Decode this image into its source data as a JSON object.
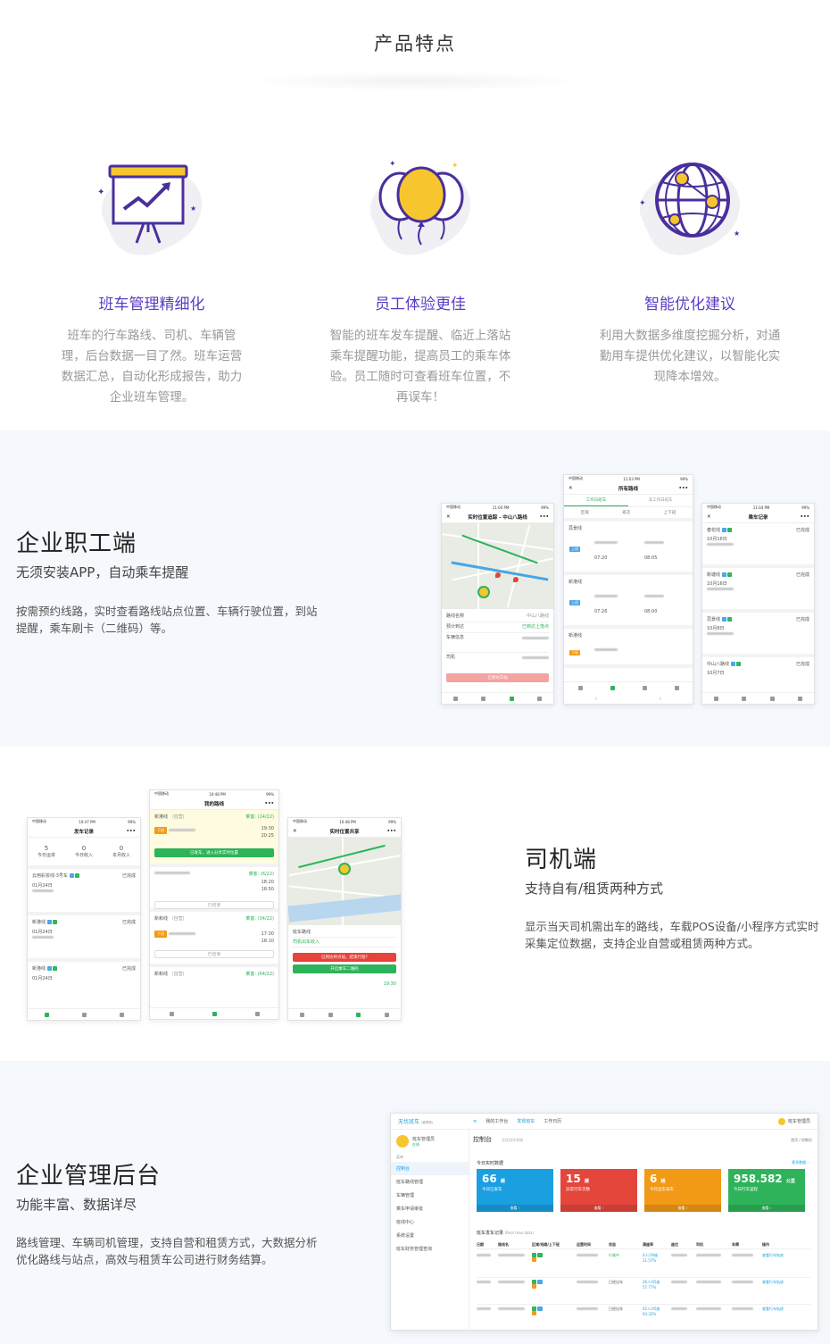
{
  "header": {
    "title": "产品特点"
  },
  "features": [
    {
      "name": "班车管理精细化",
      "icon": "presentation-chart-icon",
      "desc": "班车的行车路线、司机、车辆管理，后台数据一目了然。班车运营数据汇总，自动化形成报告，助力企业班车管理。"
    },
    {
      "name": "员工体验更佳",
      "icon": "balloon-icon",
      "desc": "智能的班车发车提醒、临近上落站乘车提醒功能，提高员工的乘车体验。员工随时可查看班车位置，不再误车！"
    },
    {
      "name": "智能优化建议",
      "icon": "globe-network-icon",
      "desc": "利用大数据多维度挖掘分析，对通勤用车提供优化建议，以智能化实现降本增效。"
    }
  ],
  "employee": {
    "title": "企业职工端",
    "subtitle": "无须安装APP，自动乘车提醒",
    "desc": "按需预约线路，实时查看路线站点位置、车辆行驶位置，到站提醒，乘车刷卡（二维码）等。",
    "phone_map": {
      "time": "11:04 PM",
      "title": "实时位置追踪 - 中山八路线",
      "route_label": "路线名称",
      "route_value": "中山八路线",
      "status_label": "预计到达",
      "status_value": "已到达上落点",
      "station_label": "车辆信息",
      "driver_label": "司机",
      "button": "已到达车站"
    },
    "phone_routes": {
      "time": "11:03 PM",
      "title": "所有路线",
      "tab_on": "工作日班车",
      "tab_off": "非工作日班车",
      "filters": [
        "区域",
        "班次",
        "上下班"
      ],
      "routes": [
        {
          "name": "荔景线",
          "tag": "上班",
          "t1": "07:20",
          "t2": "08:05"
        },
        {
          "name": "新港线",
          "tag": "上班",
          "t1": "07:26",
          "t2": "08:00"
        },
        {
          "name": "新港线",
          "tag": "下班",
          "t1": "",
          "t2": ""
        }
      ]
    },
    "phone_records": {
      "time": "11:04 PM",
      "title": "乘车记录",
      "items": [
        {
          "line": "春花线",
          "status": "已完成",
          "date": "10月16日"
        },
        {
          "line": "新塘线",
          "status": "已完成",
          "date": "10月16日"
        },
        {
          "line": "荔景线",
          "status": "已完成",
          "date": "10月8日"
        },
        {
          "line": "中山八路线",
          "status": "已完成",
          "date": "10月7日"
        }
      ]
    }
  },
  "driver": {
    "title": "司机端",
    "subtitle": "支持自有/租赁两种方式",
    "desc": "显示当天司机需出车的路线，车载POS设备/小程序方式实时采集定位数据，支持企业自营或租赁两种方式。",
    "phone_depart": {
      "time": "10:47 PM",
      "title": "发车记录",
      "stats": [
        {
          "v": "5",
          "l": "今日运单"
        },
        {
          "v": "0",
          "l": "今日收入"
        },
        {
          "v": "0",
          "l": "本月收入"
        }
      ],
      "items": [
        {
          "line": "云用彩妆线-3号车",
          "status": "已完成",
          "date": "01月24日"
        },
        {
          "line": "新港线",
          "status": "已完成",
          "date": "01月24日"
        },
        {
          "line": "新港线",
          "status": "已完成",
          "date": "01月24日"
        }
      ]
    },
    "phone_myroutes": {
      "time": "10:48 PM",
      "title": "我的路线",
      "items": [
        {
          "name": "新港线",
          "mode": "（自营)",
          "count": "乘客: (14/22)",
          "badge": "下班",
          "t1": "19:30",
          "t2": "20:25",
          "btn": "已发车，进入分享实时位置"
        },
        {
          "name": "",
          "mode": "",
          "count": "乘客: (6/22)",
          "badge": "",
          "t1": "18:20",
          "t2": "18:50",
          "btn": "已结束"
        },
        {
          "name": "新和线",
          "mode": "（自营)",
          "count": "乘客: (34/22)",
          "badge": "下班",
          "t1": "17:30",
          "t2": "18:10",
          "btn": "已结束"
        },
        {
          "name": "新和线",
          "mode": "（自营)",
          "count": "乘客: (64/22)",
          "badge": "",
          "t1": "",
          "t2": "",
          "btn": ""
        }
      ]
    },
    "phone_share": {
      "time": "10:48 PM",
      "title": "实时位置共享",
      "route_label": "班车路线",
      "income_label": "司机出车收入",
      "red_btn": "已到达终点站，结束行程?",
      "green_btn": "开启乘车二维码",
      "time_val": "19:30"
    }
  },
  "admin": {
    "title": "企业管理后台",
    "subtitle": "功能丰富、数据详尽",
    "desc": "路线管理、车辆司机管理，支持自营和租赁方式，大数据分析优化路线与站点，高效与租赁车公司进行财务结算。",
    "dash": {
      "brand": "无忧班车",
      "brand_sub": "(管理端)",
      "user": "班车管理员",
      "user_status": "在线",
      "top_tabs": [
        "我的工作台",
        "发现班车",
        "工作日历"
      ],
      "top_right": "班车管理员",
      "menu_label": "菜单",
      "menu": [
        "控制台",
        "班车路线管理",
        "车辆管理",
        "乘车申请审批",
        "班线中心",
        "系统设置",
        "班车财务管理查询"
      ],
      "page_title": "控制台",
      "page_sub": "无忧班车系统",
      "crumb": "首页 / 控制台",
      "realtime": "今日实时数据",
      "realtime_link": "更多数据 ›",
      "stats": [
        {
          "value": "66",
          "unit": "趟",
          "label": "今日已发车",
          "color": "#1a9fe0",
          "more": "查看 ›"
        },
        {
          "value": "15",
          "unit": "趟",
          "label": "异常行车次数",
          "color": "#e4463c",
          "more": "查看 ›"
        },
        {
          "value": "6",
          "unit": "趟",
          "label": "今日出车发车",
          "color": "#f29a15",
          "more": "查看 ›"
        },
        {
          "value": "958.582",
          "unit": "公里",
          "label": "今日行车里程",
          "color": "#2fb35a",
          "more": "查看 ›"
        }
      ],
      "table_title": "班车发车记录",
      "table_sub": "(Real time data)",
      "cols": [
        "日期",
        "路线名",
        "区域/线路/上下班",
        "运营时间",
        "状态",
        "满座率",
        "座位",
        "司机",
        "车牌",
        "操作"
      ],
      "rows": [
        {
          "status": "行驶中",
          "rate": "4人/19座 21.57%",
          "op": "查看行车轨迹"
        },
        {
          "status": "已经出车",
          "rate": "26人/45座 57.77%",
          "op": "查看行车轨迹"
        },
        {
          "status": "已经出车",
          "rate": "42人/45座 93.33%",
          "op": "查看行车轨迹"
        }
      ]
    }
  },
  "colors": {
    "accent": "#5b3cc4",
    "green": "#2db35a",
    "band": "#f5f8fc"
  }
}
